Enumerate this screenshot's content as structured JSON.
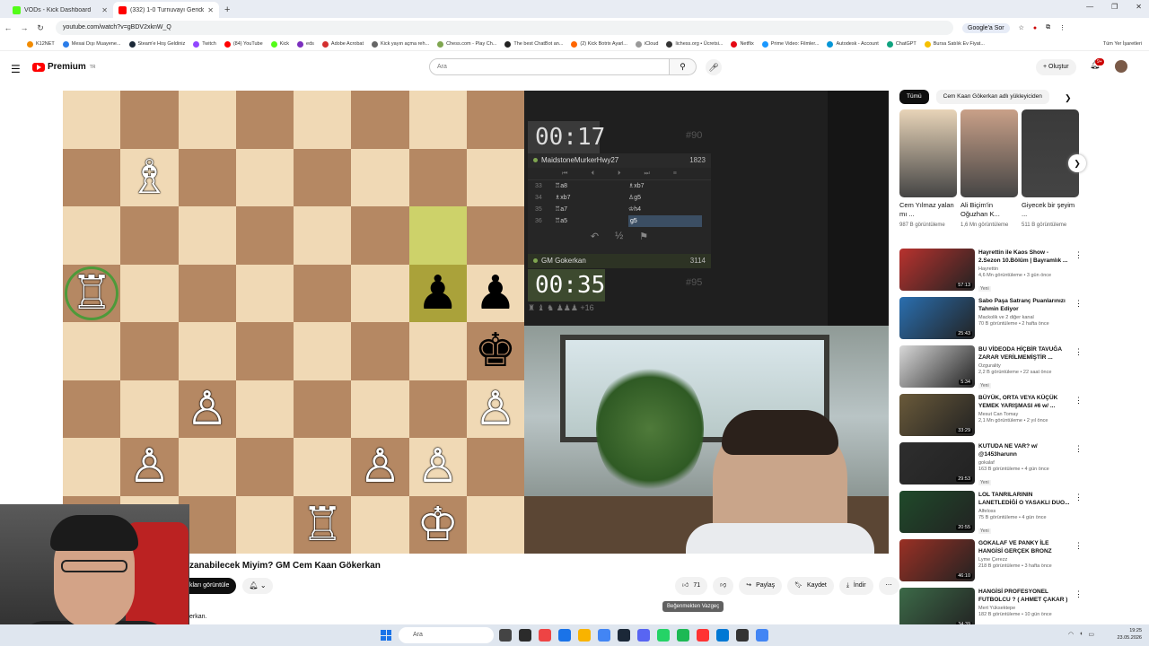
{
  "browser": {
    "tabs": [
      {
        "title": "VODs - Kick Dashboard",
        "color": "#53fc18",
        "active": false
      },
      {
        "title": "(332) 1-0 Turnuvayı Gerido",
        "color": "#ff0000",
        "active": true
      }
    ],
    "url": "youtube.com/watch?v=gBDV2xknW_Q",
    "google_label": "Google'a Sor",
    "bookmarks": [
      "K12NET",
      "Mesai Dışı Muayene...",
      "Steam'e Hoş Geldiniz",
      "Twitch",
      "(84) YouTube",
      "Kick",
      "eds",
      "Adobe Acrobat",
      "Kick yayın açma reh...",
      "Chess.com - Play Ch...",
      "The best ChatBot an...",
      "(2) Kick Botrix Ayarl...",
      "iCloud",
      "lichess.org • Ücretsi...",
      "Netflix",
      "Prime Video: Filmler...",
      "Autodesk - Account",
      "ChatGPT",
      "Bursa Satılık Ev Fiyat..."
    ],
    "all_bookmarks": "Tüm Yer İşaretleri"
  },
  "youtube": {
    "logo_text": "Premium",
    "region": "TR",
    "search_placeholder": "Ara",
    "create_label": "Oluştur",
    "notif_count": "9+"
  },
  "chess": {
    "board": [
      [
        "",
        "",
        "",
        "",
        "",
        "",
        "",
        ""
      ],
      [
        "",
        "wB",
        "",
        "",
        "",
        "",
        "",
        ""
      ],
      [
        "",
        "",
        "",
        "",
        "",
        "",
        "",
        ""
      ],
      [
        "wR",
        "",
        "",
        "",
        "",
        "",
        "bP",
        "bP"
      ],
      [
        "",
        "",
        "",
        "",
        "",
        "",
        "",
        "bK"
      ],
      [
        "",
        "",
        "wP",
        "",
        "",
        "",
        "",
        "wP"
      ],
      [
        "",
        "wP",
        "",
        "",
        "",
        "wP",
        "wP",
        ""
      ],
      [
        "",
        "",
        "",
        "",
        "wR",
        "",
        "wK",
        ""
      ]
    ],
    "highlight": [
      [
        2,
        6
      ],
      [
        3,
        6
      ]
    ],
    "top_clock": "00:17",
    "bottom_clock": "00:35",
    "top_game_no": "#90",
    "bottom_game_no": "#95",
    "top_player": "MaidstoneMurkerHwy27",
    "top_rating": "1823",
    "bottom_player": "GM Gokerkan",
    "bottom_rating": "3114",
    "moves": [
      {
        "n": "33",
        "w": "♖a8",
        "b": "♗xb7"
      },
      {
        "n": "34",
        "w": "♗xb7",
        "b": "♙g5"
      },
      {
        "n": "35",
        "w": "♖a7",
        "b": "♔h4"
      },
      {
        "n": "36",
        "w": "♖a5",
        "b": "g5"
      }
    ],
    "captured": "♜ ♝ ♞ ♟♟♟  +16",
    "draw_label": "½"
  },
  "video": {
    "title": "zanabilecek Miyim? GM Cem Kaan Gökerkan",
    "join_label": "kları görüntüle",
    "likes": "71",
    "share": "Paylaş",
    "save": "Kaydet",
    "download": "İndir",
    "tooltip": "Beğenmekten Vazgeç",
    "desc_fragment": "erkan."
  },
  "sidebar": {
    "chips": [
      "Tümü",
      "Cem Kaan Gökerkan adlı yükleyiciden"
    ],
    "shorts": [
      {
        "title": "Cem Yılmaz yalan mı ...",
        "views": "987 B görüntüleme",
        "color": "#e8d4b8"
      },
      {
        "title": "Ali Biçim'in Oğuzhan K...",
        "views": "1,6 Mn görüntüleme",
        "color": "#c9a088"
      },
      {
        "title": "Giyecek bir şeyim ...",
        "views": "511 B görüntüleme",
        "color": "#3a3a3a"
      }
    ],
    "recs": [
      {
        "title": "Hayrettin ile Kaos Show - 2.Sezon 10.Bölüm | Bayramlık ...",
        "channel": "Hayrettin",
        "stats": "4,6 Mn görüntüleme • 3 gün önce",
        "dur": "57:13",
        "new": "Yeni",
        "color": "#b8322e"
      },
      {
        "title": "Sabo Paşa Satranç Puanlarınızı Tahmin Ediyor",
        "channel": "Mackolik ve 2 diğer kanal",
        "stats": "70 B görüntüleme • 2 hafta önce",
        "dur": "25:43",
        "new": "",
        "color": "#2a6fb0"
      },
      {
        "title": "BU VİDEODA HİÇBİR TAVUĞA ZARAR VERİLMEMİŞTİR ...",
        "channel": "Ozgurality",
        "stats": "2,2 B görüntüleme • 22 saat önce",
        "dur": "5:34",
        "new": "Yeni",
        "color": "#d8d8d8"
      },
      {
        "title": "BÜYÜK, ORTA VEYA KÜÇÜK YEMEK YARIŞMASI #6 w/ ...",
        "channel": "Mesut Can Tomay",
        "stats": "2,1 Mn görüntüleme • 2 yıl önce",
        "dur": "33:29",
        "new": "",
        "color": "#6a5a3a"
      },
      {
        "title": "KUTUDA NE VAR? w/ @1453harunn",
        "channel": "gokalaf",
        "stats": "163 B görüntüleme • 4 gün önce",
        "dur": "29:53",
        "new": "Yeni",
        "color": "#2e2e2e"
      },
      {
        "title": "LOL TANRILARININ LANETLEDİĞİ O YASAKLI DUO...",
        "channel": "Alfeloss",
        "stats": "75 B görüntüleme • 4 gün önce",
        "dur": "20:55",
        "new": "Yeni",
        "color": "#1f4a2a"
      },
      {
        "title": "GOKALAF VE PANKY İLE HANGİSİ GERÇEK BRONZ",
        "channel": "Lyme Çerezz",
        "stats": "218 B görüntüleme • 3 hafta önce",
        "dur": "46:10",
        "new": "",
        "color": "#9a3024"
      },
      {
        "title": "HANGİSİ PROFESYONEL FUTBOLCU ? ( AHMET ÇAKAR )",
        "channel": "Mert Yüksektepe",
        "stats": "182 B görüntüleme • 10 gün önce",
        "dur": "34:39",
        "new": "",
        "color": "#3c6a48"
      }
    ]
  },
  "taskbar": {
    "search": "Ara",
    "time": "19:25",
    "date": "23.05.2026",
    "lang": "TUR"
  }
}
